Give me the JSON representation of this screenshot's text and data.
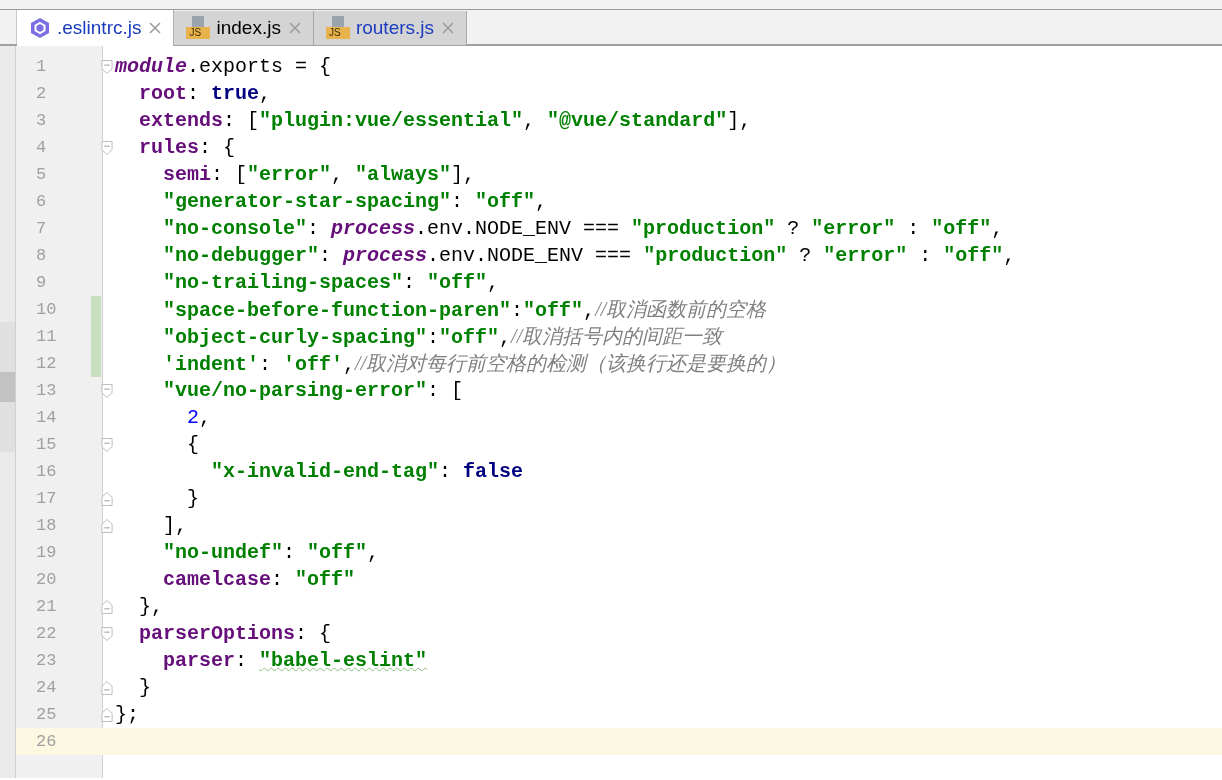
{
  "tabs": [
    {
      "label": ".eslintrc.js",
      "kind": "eslint",
      "selected": true,
      "color": "#1a3cc0"
    },
    {
      "label": "index.js",
      "kind": "js",
      "badge": "JS",
      "selected": false,
      "color": "#000000"
    },
    {
      "label": "routers.js",
      "kind": "js",
      "badge": "JS",
      "selected": false,
      "color": "#1a3cc0"
    }
  ],
  "editor": {
    "lines": [
      {
        "number": "1",
        "kind": "fold-start",
        "changed": false,
        "current": false,
        "tokens": [
          {
            "kind": "italic",
            "text": "module"
          },
          {
            "kind": "plain",
            "text": ".exports = {"
          }
        ]
      },
      {
        "number": "2",
        "kind": "plain",
        "changed": false,
        "current": false,
        "tokens": [
          {
            "kind": "prop",
            "text": "  root"
          },
          {
            "kind": "plain",
            "text": ": "
          },
          {
            "kind": "kw",
            "text": "true"
          },
          {
            "kind": "plain",
            "text": ","
          }
        ]
      },
      {
        "number": "3",
        "kind": "plain",
        "changed": false,
        "current": false,
        "tokens": [
          {
            "kind": "prop",
            "text": "  extends"
          },
          {
            "kind": "plain",
            "text": ": ["
          },
          {
            "kind": "str",
            "text": "\"plugin:vue/essential\""
          },
          {
            "kind": "plain",
            "text": ", "
          },
          {
            "kind": "str",
            "text": "\"@vue/standard\""
          },
          {
            "kind": "plain",
            "text": "],"
          }
        ]
      },
      {
        "number": "4",
        "kind": "fold-start",
        "changed": false,
        "current": false,
        "tokens": [
          {
            "kind": "prop",
            "text": "  rules"
          },
          {
            "kind": "plain",
            "text": ": {"
          }
        ]
      },
      {
        "number": "5",
        "kind": "plain",
        "changed": false,
        "current": false,
        "tokens": [
          {
            "kind": "prop",
            "text": "    semi"
          },
          {
            "kind": "plain",
            "text": ": ["
          },
          {
            "kind": "str",
            "text": "\"error\""
          },
          {
            "kind": "plain",
            "text": ", "
          },
          {
            "kind": "str",
            "text": "\"always\""
          },
          {
            "kind": "plain",
            "text": "],"
          }
        ]
      },
      {
        "number": "6",
        "kind": "plain",
        "changed": false,
        "current": false,
        "tokens": [
          {
            "kind": "str",
            "text": "    \"generator-star-spacing\""
          },
          {
            "kind": "plain",
            "text": ": "
          },
          {
            "kind": "str",
            "text": "\"off\""
          },
          {
            "kind": "plain",
            "text": ","
          }
        ]
      },
      {
        "number": "7",
        "kind": "plain",
        "changed": false,
        "current": false,
        "tokens": [
          {
            "kind": "str",
            "text": "    \"no-console\""
          },
          {
            "kind": "plain",
            "text": ": "
          },
          {
            "kind": "italic",
            "text": "process"
          },
          {
            "kind": "plain",
            "text": ".env.NODE_ENV === "
          },
          {
            "kind": "str",
            "text": "\"production\""
          },
          {
            "kind": "plain",
            "text": " ? "
          },
          {
            "kind": "str",
            "text": "\"error\""
          },
          {
            "kind": "plain",
            "text": " : "
          },
          {
            "kind": "str",
            "text": "\"off\""
          },
          {
            "kind": "plain",
            "text": ","
          }
        ]
      },
      {
        "number": "8",
        "kind": "plain",
        "changed": false,
        "current": false,
        "tokens": [
          {
            "kind": "str",
            "text": "    \"no-debugger\""
          },
          {
            "kind": "plain",
            "text": ": "
          },
          {
            "kind": "italic",
            "text": "process"
          },
          {
            "kind": "plain",
            "text": ".env.NODE_ENV === "
          },
          {
            "kind": "str",
            "text": "\"production\""
          },
          {
            "kind": "plain",
            "text": " ? "
          },
          {
            "kind": "str",
            "text": "\"error\""
          },
          {
            "kind": "plain",
            "text": " : "
          },
          {
            "kind": "str",
            "text": "\"off\""
          },
          {
            "kind": "plain",
            "text": ","
          }
        ]
      },
      {
        "number": "9",
        "kind": "plain",
        "changed": false,
        "current": false,
        "tokens": [
          {
            "kind": "str",
            "text": "    \"no-trailing-spaces\""
          },
          {
            "kind": "plain",
            "text": ": "
          },
          {
            "kind": "str",
            "text": "\"off\""
          },
          {
            "kind": "plain",
            "text": ","
          }
        ]
      },
      {
        "number": "10",
        "kind": "plain",
        "changed": true,
        "current": false,
        "tokens": [
          {
            "kind": "str",
            "text": "    \"space-before-function-paren\""
          },
          {
            "kind": "plain",
            "text": ":"
          },
          {
            "kind": "str",
            "text": "\"off\""
          },
          {
            "kind": "plain",
            "text": ","
          },
          {
            "kind": "comment",
            "text": "//取消函数前的空格"
          }
        ]
      },
      {
        "number": "11",
        "kind": "plain",
        "changed": true,
        "current": false,
        "tokens": [
          {
            "kind": "str",
            "text": "    \"object-curly-spacing\""
          },
          {
            "kind": "plain",
            "text": ":"
          },
          {
            "kind": "str",
            "text": "\"off\""
          },
          {
            "kind": "plain",
            "text": ","
          },
          {
            "kind": "comment",
            "text": "//取消括号内的间距一致"
          }
        ]
      },
      {
        "number": "12",
        "kind": "plain",
        "changed": true,
        "current": false,
        "tokens": [
          {
            "kind": "str",
            "text": "    'indent'"
          },
          {
            "kind": "plain",
            "text": ": "
          },
          {
            "kind": "str",
            "text": "'off'"
          },
          {
            "kind": "plain",
            "text": ","
          },
          {
            "kind": "comment",
            "text": "//取消对每行前空格的检测（该换行还是要换的）"
          }
        ]
      },
      {
        "number": "13",
        "kind": "fold-start",
        "changed": false,
        "current": false,
        "tokens": [
          {
            "kind": "str",
            "text": "    \"vue/no-parsing-error\""
          },
          {
            "kind": "plain",
            "text": ": ["
          }
        ]
      },
      {
        "number": "14",
        "kind": "plain",
        "changed": false,
        "current": false,
        "tokens": [
          {
            "kind": "num",
            "text": "      2"
          },
          {
            "kind": "plain",
            "text": ","
          }
        ]
      },
      {
        "number": "15",
        "kind": "fold-start",
        "changed": false,
        "current": false,
        "tokens": [
          {
            "kind": "plain",
            "text": "      {"
          }
        ]
      },
      {
        "number": "16",
        "kind": "plain",
        "changed": false,
        "current": false,
        "tokens": [
          {
            "kind": "str",
            "text": "        \"x-invalid-end-tag\""
          },
          {
            "kind": "plain",
            "text": ": "
          },
          {
            "kind": "kw",
            "text": "false"
          }
        ]
      },
      {
        "number": "17",
        "kind": "fold-end",
        "changed": false,
        "current": false,
        "tokens": [
          {
            "kind": "plain",
            "text": "      }"
          }
        ]
      },
      {
        "number": "18",
        "kind": "fold-end",
        "changed": false,
        "current": false,
        "tokens": [
          {
            "kind": "plain",
            "text": "    ],"
          }
        ]
      },
      {
        "number": "19",
        "kind": "plain",
        "changed": false,
        "current": false,
        "tokens": [
          {
            "kind": "str",
            "text": "    \"no-undef\""
          },
          {
            "kind": "plain",
            "text": ": "
          },
          {
            "kind": "str",
            "text": "\"off\""
          },
          {
            "kind": "plain",
            "text": ","
          }
        ]
      },
      {
        "number": "20",
        "kind": "plain",
        "changed": false,
        "current": false,
        "tokens": [
          {
            "kind": "prop",
            "text": "    camelcase"
          },
          {
            "kind": "plain",
            "text": ": "
          },
          {
            "kind": "str",
            "text": "\"off\""
          }
        ]
      },
      {
        "number": "21",
        "kind": "fold-end",
        "changed": false,
        "current": false,
        "tokens": [
          {
            "kind": "plain",
            "text": "  },"
          }
        ]
      },
      {
        "number": "22",
        "kind": "fold-start",
        "changed": false,
        "current": false,
        "tokens": [
          {
            "kind": "prop",
            "text": "  parserOptions"
          },
          {
            "kind": "plain",
            "text": ": {"
          }
        ]
      },
      {
        "number": "23",
        "kind": "plain",
        "changed": false,
        "current": false,
        "tokens": [
          {
            "kind": "prop",
            "text": "    parser"
          },
          {
            "kind": "plain",
            "text": ": "
          },
          {
            "kind": "flagged",
            "text": "\"babel-eslint\""
          }
        ]
      },
      {
        "number": "24",
        "kind": "fold-end",
        "changed": false,
        "current": false,
        "tokens": [
          {
            "kind": "plain",
            "text": "  }"
          }
        ]
      },
      {
        "number": "25",
        "kind": "fold-end",
        "changed": false,
        "current": false,
        "tokens": [
          {
            "kind": "plain",
            "text": "};"
          }
        ]
      },
      {
        "number": "26",
        "kind": "plain",
        "changed": false,
        "current": true
      }
    ]
  }
}
